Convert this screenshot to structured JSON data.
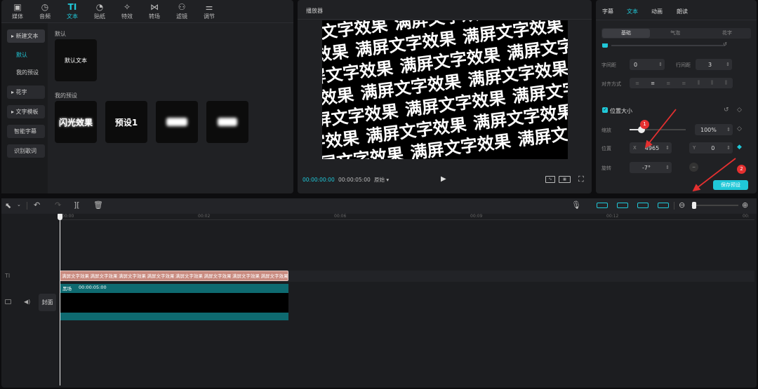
{
  "toolbar": {
    "tabs": [
      {
        "label": "媒体",
        "icon": "media-icon"
      },
      {
        "label": "音频",
        "icon": "audio-icon"
      },
      {
        "label": "文本",
        "icon": "text-icon"
      },
      {
        "label": "贴纸",
        "icon": "sticker-icon"
      },
      {
        "label": "特效",
        "icon": "effects-icon"
      },
      {
        "label": "转场",
        "icon": "transition-icon"
      },
      {
        "label": "滤镜",
        "icon": "filter-icon"
      },
      {
        "label": "调节",
        "icon": "adjust-icon"
      }
    ],
    "active": "文本"
  },
  "sidebar": {
    "items": [
      {
        "label": "▸ 新建文本"
      },
      {
        "label": "默认"
      },
      {
        "label": "我的预设"
      },
      {
        "label": "▸ 花字"
      },
      {
        "label": "▸ 文字模板"
      },
      {
        "label": "智能字幕"
      },
      {
        "label": "识别歌词"
      }
    ]
  },
  "library": {
    "default_section": "默认",
    "default_card": "默认文本",
    "presets_section": "我的预设",
    "presets": [
      "闪光效果",
      "预设1",
      "",
      ""
    ]
  },
  "player": {
    "title": "播放器",
    "preview_text": "满屏文字效果",
    "current_time": "00:00:00:00",
    "total_time": "00:00:05:00",
    "ratio_label": "原始"
  },
  "inspector": {
    "tabs": [
      "字幕",
      "文本",
      "动画",
      "朗读"
    ],
    "active_tab": "文本",
    "sub_tabs": [
      "基础",
      "气泡",
      "花字"
    ],
    "active_sub_tab": "基础",
    "letter_spacing_label": "字间距",
    "letter_spacing": "0",
    "line_spacing_label": "行间距",
    "line_spacing": "3",
    "align_label": "对齐方式",
    "position_size_label": "位置大小",
    "scale_label": "缩放",
    "scale_value": "100%",
    "position_label": "位置",
    "x_label": "X",
    "x_value": "4965",
    "y_label": "Y",
    "y_value": "0",
    "rotation_label": "旋转",
    "rotation_value": "-7°",
    "save_preset": "保存预设",
    "annotations": [
      "1",
      "2"
    ]
  },
  "timeline": {
    "ruler": [
      "00:00",
      "00:02",
      "00:06",
      "00:09",
      "00:12",
      "00:"
    ],
    "text_track_label": "TI",
    "text_clip_label": "满屏文字效果",
    "text_clip_count": 8,
    "cover_label": "封面",
    "video_clip_name": "黑场",
    "video_clip_duration": "00:00:05:00"
  },
  "colors": {
    "accent": "#20c8d8",
    "annotation": "#e53030",
    "text_clip": "#c98b80",
    "video_clip": "#0e6a70"
  }
}
